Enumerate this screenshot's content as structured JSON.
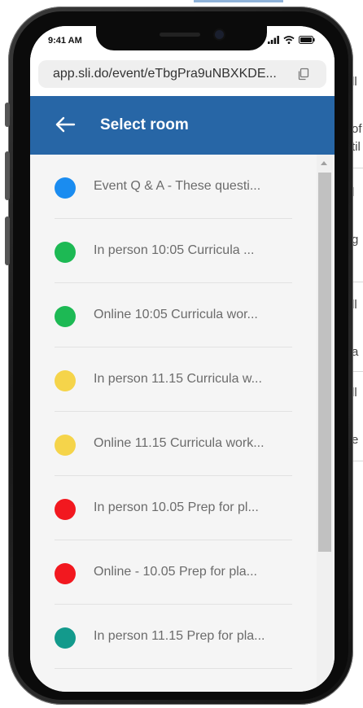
{
  "status_bar": {
    "time": "9:41 AM"
  },
  "browser": {
    "url": "app.sli.do/event/eTbgPra9uNBXKDE..."
  },
  "header": {
    "title": "Select room"
  },
  "rooms": [
    {
      "label": "Event Q & A - These questi...",
      "color": "#1a8cf0"
    },
    {
      "label": "In person 10:05 Curricula ...",
      "color": "#1db954"
    },
    {
      "label": "Online 10:05 Curricula wor...",
      "color": "#1db954"
    },
    {
      "label": "In person 11.15 Curricula w...",
      "color": "#f5d44a"
    },
    {
      "label": "Online 11.15 Curricula work...",
      "color": "#f5d44a"
    },
    {
      "label": "In person 10.05 Prep for pl...",
      "color": "#f2181f"
    },
    {
      "label": "Online - 10.05 Prep for pla...",
      "color": "#f2181f"
    },
    {
      "label": "In person 11.15 Prep for pla...",
      "color": "#139a8c"
    }
  ],
  "colors": {
    "header": "#2766a6",
    "list_background": "#f5f5f5"
  },
  "icons": {
    "back": "arrow-left-icon",
    "copy": "copy-icon",
    "signal": "signal-icon",
    "wifi": "wifi-icon",
    "battery": "battery-icon"
  }
}
